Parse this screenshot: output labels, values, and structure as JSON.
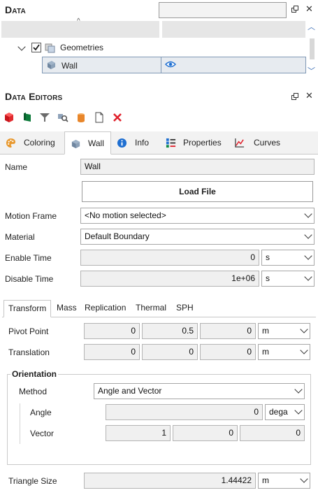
{
  "data_panel": {
    "title": "Data",
    "tree": {
      "geometries_label": "Geometries",
      "wall_label": "Wall"
    }
  },
  "editors_panel": {
    "title": "Data Editors",
    "toolbar_icons": [
      "cube-red-icon",
      "flag-green-icon",
      "funnel-icon",
      "search-object-icon",
      "cylinder-icon",
      "document-icon",
      "delete-icon"
    ]
  },
  "tabs": [
    {
      "label": "Coloring",
      "icon": "palette-icon"
    },
    {
      "label": "Wall",
      "icon": "wall-icon"
    },
    {
      "label": "Info",
      "icon": "info-icon"
    },
    {
      "label": "Properties",
      "icon": "properties-icon"
    },
    {
      "label": "Curves",
      "icon": "curves-icon"
    }
  ],
  "active_tab": "Wall",
  "form": {
    "name_label": "Name",
    "name_value": "Wall",
    "load_file_label": "Load File",
    "motion_frame_label": "Motion Frame",
    "motion_frame_value": "<No motion selected>",
    "material_label": "Material",
    "material_value": "Default Boundary",
    "enable_time_label": "Enable Time",
    "enable_time_value": "0",
    "enable_time_unit": "s",
    "disable_time_label": "Disable Time",
    "disable_time_value": "1e+06",
    "disable_time_unit": "s"
  },
  "subtabs": [
    "Transform",
    "Mass",
    "Replication",
    "Thermal",
    "SPH"
  ],
  "active_subtab": "Transform",
  "transform": {
    "pivot_label": "Pivot Point",
    "pivot_values": [
      "0",
      "0.5",
      "0"
    ],
    "pivot_unit": "m",
    "translation_label": "Translation",
    "translation_values": [
      "0",
      "0",
      "0"
    ],
    "translation_unit": "m",
    "orientation_title": "Orientation",
    "method_label": "Method",
    "method_value": "Angle and Vector",
    "angle_label": "Angle",
    "angle_value": "0",
    "angle_unit": "dega",
    "vector_label": "Vector",
    "vector_values": [
      "1",
      "0",
      "0"
    ]
  },
  "triangle": {
    "label": "Triangle Size",
    "value": "1.44422",
    "unit": "m"
  }
}
